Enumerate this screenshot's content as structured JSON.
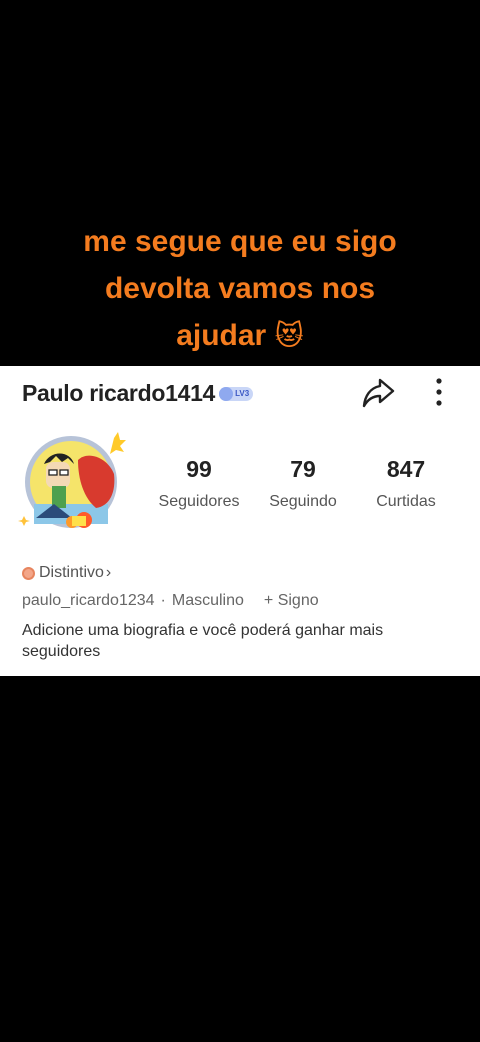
{
  "caption": {
    "line1": "me segue que eu sigo",
    "line2": "devolta vamos nos",
    "line3": "ajudar",
    "emoji": "😻"
  },
  "profile": {
    "username": "Paulo ricardo1414",
    "level": "LV3",
    "stats": [
      {
        "value": "99",
        "label": "Seguidores"
      },
      {
        "value": "79",
        "label": "Seguindo"
      },
      {
        "value": "847",
        "label": "Curtidas"
      }
    ],
    "badge_label": "Distintivo",
    "badge_chevron": "›",
    "handle": "paulo_ricardo1234",
    "separator": "·",
    "gender": "Masculino",
    "sign_button": "+ Signo",
    "bio": "Adicione uma biografia e você poderá ganhar mais seguidores"
  },
  "icons": {
    "share": "share-arrow-icon",
    "more": "more-vertical-icon",
    "badge": "badge-icon"
  },
  "colors": {
    "caption": "#f47c1f",
    "card_bg": "#ffffff",
    "page_bg": "#000000"
  }
}
